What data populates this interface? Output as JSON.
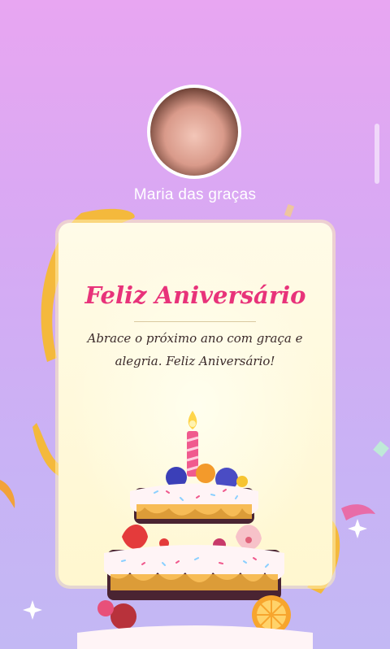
{
  "profile": {
    "name": "Maria das graças"
  },
  "card": {
    "title": "Feliz Aniversário",
    "message_line1": "Abrace o próximo ano com graça e",
    "message_line2": "alegria. Feliz Aniversário!"
  },
  "colors": {
    "title": "#e8337a",
    "background_top": "#e8a6f2",
    "background_bottom": "#c3b8f4",
    "card": "#fff8d6"
  }
}
